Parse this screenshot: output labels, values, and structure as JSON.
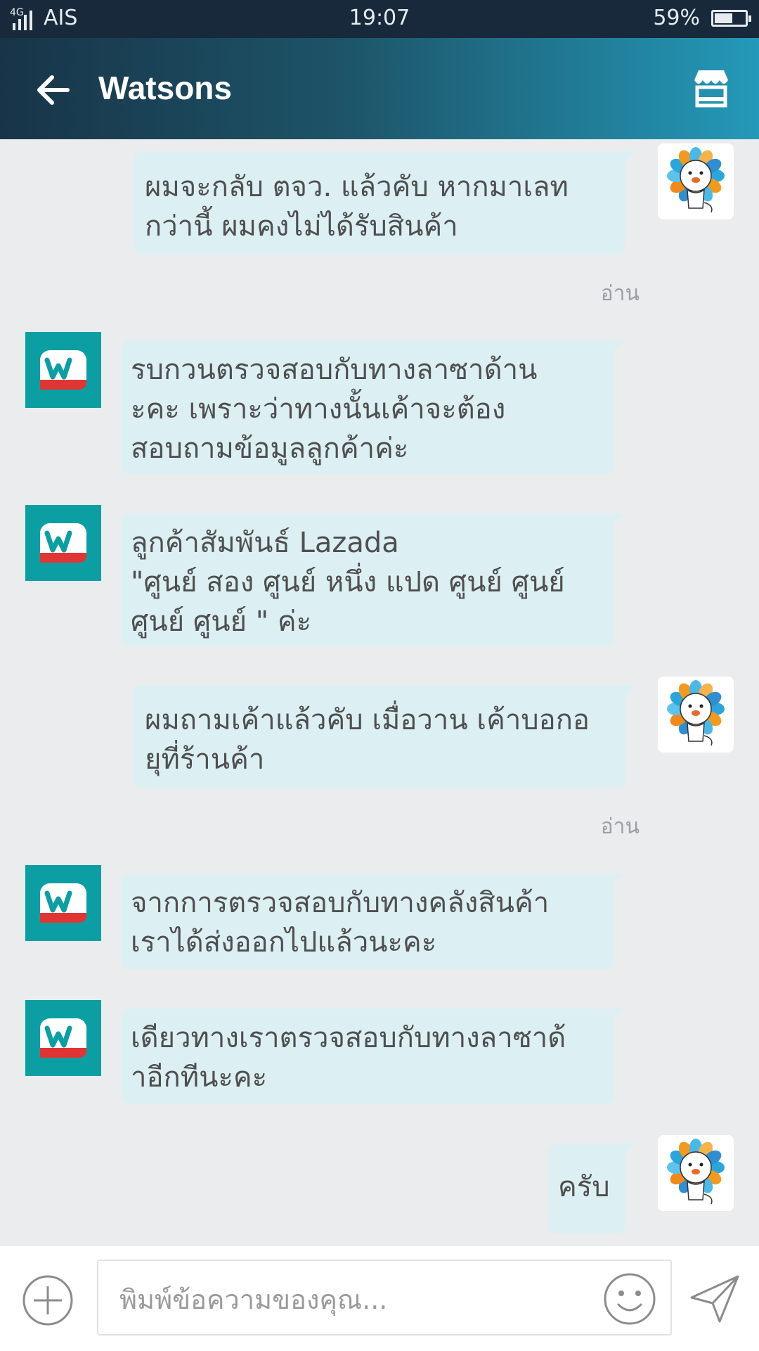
{
  "status_bar": {
    "network": "4G",
    "carrier": "AIS",
    "time": "19:07",
    "battery": "59%",
    "battery_level": 0.59
  },
  "header": {
    "title": "Watsons",
    "back_icon": "arrow-left-icon",
    "store_icon": "store-icon"
  },
  "messages": [
    {
      "side": "out",
      "text": "ผมจะกลับ ตจว. แล้วคับ หากมาเลท\nกว่านี้ ผมคงไม่ได้รับสินค้า",
      "read": "อ่าน"
    },
    {
      "side": "in",
      "text": "รบกวนตรวจสอบกับทางลาซาด้าน\nะคะ เพราะว่าทางนั้นเค้าจะต้อง\nสอบถามข้อมูลลูกค้าค่ะ"
    },
    {
      "side": "in",
      "text": "ลูกค้าสัมพันธ์ Lazada\n\"ศูนย์ สอง ศูนย์ หนึ่ง แปด ศูนย์ ศูนย์\nศูนย์ ศูนย์ \" ค่ะ"
    },
    {
      "side": "out",
      "text": "ผมถามเค้าแล้วคับ เมื่อวาน เค้าบอกอ\nยุที่ร้านค้า",
      "read": "อ่าน"
    },
    {
      "side": "in",
      "text": "จากการตรวจสอบกับทางคลังสินค้า\nเราได้ส่งออกไปแล้วนะคะ"
    },
    {
      "side": "in",
      "text": "เดียวทางเราตรวจสอบกับทางลาซาด้\nาอีกทีนะคะ"
    },
    {
      "side": "out",
      "text": "ครับ"
    }
  ],
  "input": {
    "placeholder": "พิมพ์ข้อความของคุณ...",
    "add_icon": "plus-circle-icon",
    "emoji_icon": "smiley-icon",
    "send_icon": "send-icon"
  },
  "colors": {
    "status_bar": "#17293a",
    "header_start": "#183448",
    "header_end": "#2499b9",
    "bubble": "#dcf0f4",
    "background": "#ebeced",
    "watsons_teal": "#0b9fa3"
  }
}
